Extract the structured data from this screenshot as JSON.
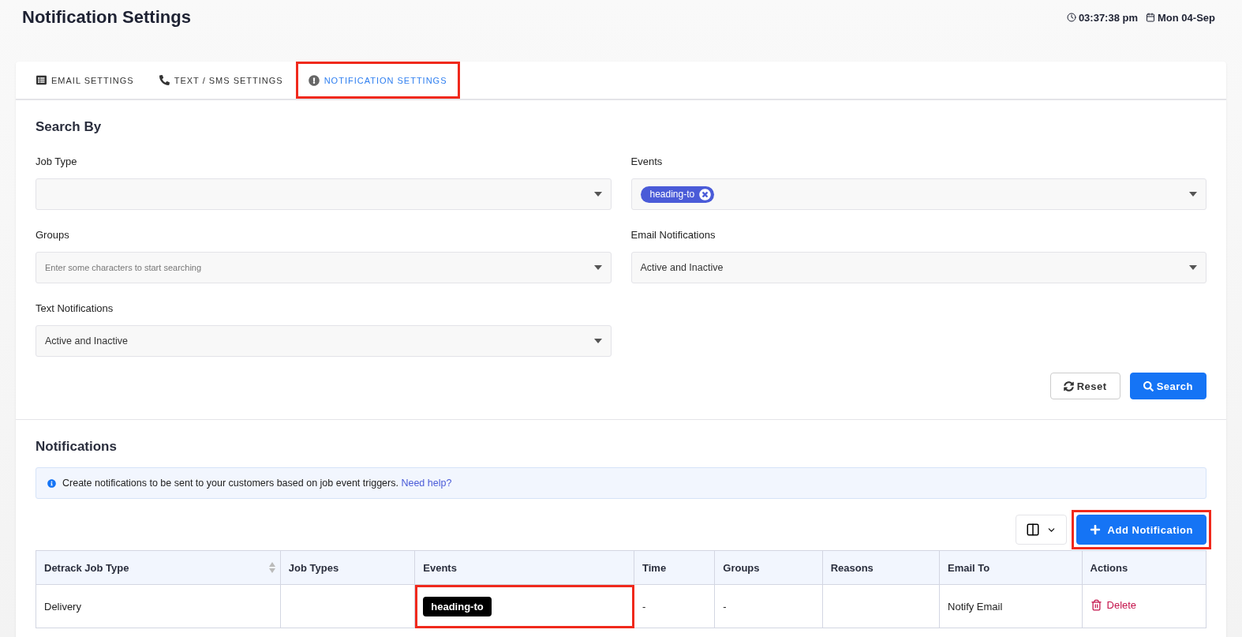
{
  "page": {
    "title": "Notification Settings",
    "time": "03:37:38 pm",
    "date": "Mon 04-Sep"
  },
  "tabs": [
    {
      "label": "EMAIL SETTINGS",
      "kind": "list",
      "selected": false,
      "highlighted": false
    },
    {
      "label": "TEXT / SMS SETTINGS",
      "kind": "phone",
      "selected": false,
      "highlighted": false
    },
    {
      "label": "NOTIFICATION SETTINGS",
      "kind": "alert",
      "selected": true,
      "highlighted": true
    }
  ],
  "search": {
    "title": "Search By",
    "fields": [
      {
        "label": "Job Type"
      },
      {
        "label": "Events",
        "tags": [
          "heading-to"
        ]
      },
      {
        "label": "Groups",
        "placeholder": "Enter some characters to start searching"
      },
      {
        "label": "Email Notifications",
        "value": "Active and Inactive"
      },
      {
        "label": "Text Notifications",
        "value": "Active and Inactive"
      }
    ],
    "buttons": [
      {
        "label": "Reset",
        "kind": "reset"
      },
      {
        "label": "Search",
        "kind": "search"
      }
    ]
  },
  "notifications": {
    "title": "Notifications",
    "info": "Create notifications to be sent to your customers based on job event triggers.",
    "help_link": "Need help?",
    "add_button": {
      "label": "Add Notification",
      "highlighted": true
    },
    "table": {
      "columns": [
        "Detrack Job Type",
        "Job Types",
        "Events",
        "Time",
        "Groups",
        "Reasons",
        "Email To",
        "Actions"
      ],
      "rows": [
        {
          "detrack_job_type": "Delivery",
          "job_types": "",
          "event": "heading-to",
          "event_highlighted": true,
          "time": "-",
          "groups": "-",
          "reasons": "",
          "email_to": "Notify Email",
          "action": "Delete"
        }
      ]
    }
  }
}
